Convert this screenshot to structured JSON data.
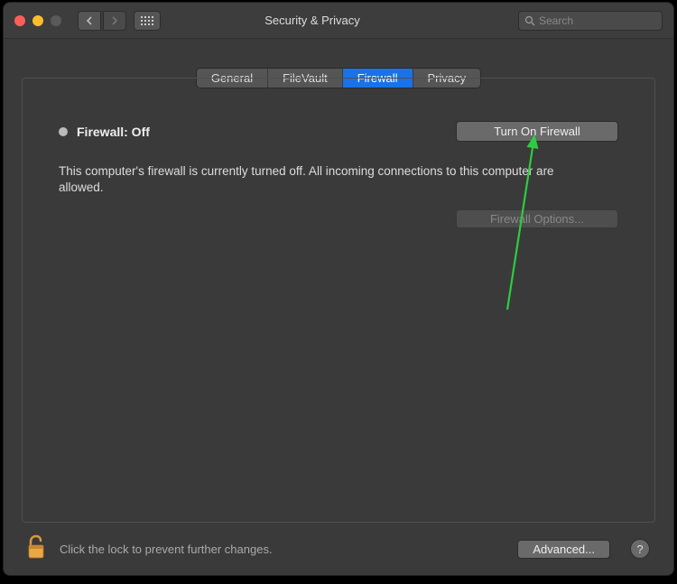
{
  "window": {
    "title": "Security & Privacy"
  },
  "search": {
    "placeholder": "Search"
  },
  "tabs": {
    "general": "General",
    "filevault": "FileVault",
    "firewall": "Firewall",
    "privacy": "Privacy"
  },
  "firewall": {
    "status_label": "Firewall: Off",
    "turn_on_label": "Turn On Firewall",
    "description": "This computer's firewall is currently turned off. All incoming connections to this computer are allowed.",
    "options_label": "Firewall Options..."
  },
  "footer": {
    "lock_text": "Click the lock to prevent further changes.",
    "advanced_label": "Advanced...",
    "help_label": "?"
  }
}
